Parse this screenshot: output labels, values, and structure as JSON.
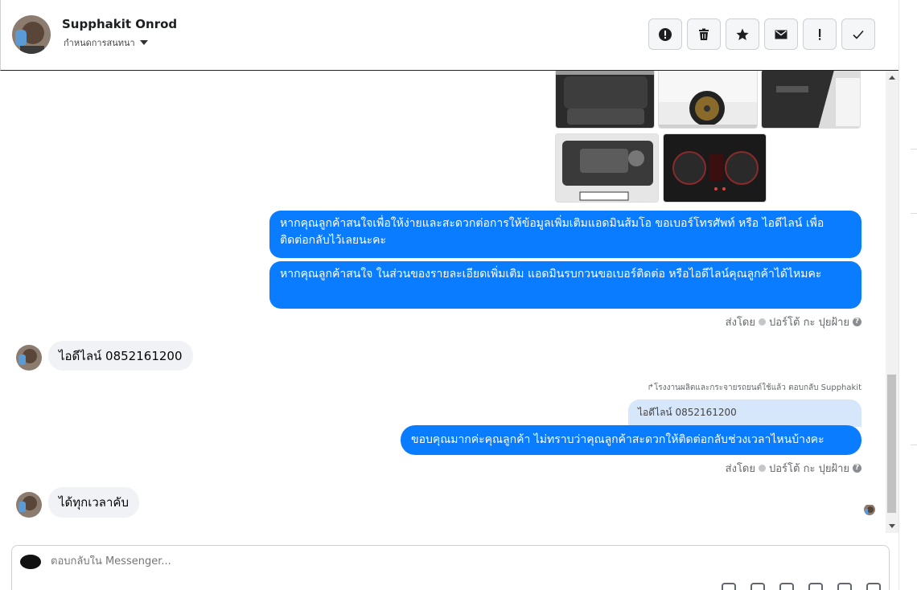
{
  "header": {
    "contact_name": "Supphakit Onrod",
    "assign_label": "กำหนดการสนทนา"
  },
  "actions": [
    {
      "name": "report-spam",
      "icon": "exclamation-circle-icon"
    },
    {
      "name": "delete",
      "icon": "trash-icon"
    },
    {
      "name": "star",
      "icon": "star-icon"
    },
    {
      "name": "mark-unread",
      "icon": "envelope-icon"
    },
    {
      "name": "mark-important",
      "icon": "exclamation-icon"
    },
    {
      "name": "mark-done",
      "icon": "check-icon"
    }
  ],
  "thread": {
    "outgoing_1": "หากคุณลูกค้าสนใจเพื่อให้ง่ายและสะดวกต่อการให้ข้อมูลเพิ่มเติมแอดมินส้มโอ ขอเบอร์โทรศัพท์ หรือ ไอดีไลน์ เพื่อติดต่อกลับไว้เลยนะคะ",
    "outgoing_2": "หากคุณลูกค้าสนใจ ในส่วนของรายละเอียดเพิ่มเติม แอดมินรบกวนขอเบอร์ติดต่อ หรือไอดีไลน์คุณลูกค้าได้ไหมคะ",
    "sent_by_1_prefix": "ส่งโดย",
    "sent_by_1_name": "ปอร์โต้ กะ ปุยฝ้าย",
    "incoming_1": "ไอดีไลน์ 0852161200",
    "reply_note": "โรงงานผลิตและกระจายรถยนต์ใช้แล้ว ตอบกลับ Supphakit",
    "quoted_text": "ไอดีไลน์ 0852161200",
    "outgoing_3": "ขอบคุณมากค่ะคุณลูกค้า ไม่ทราบว่าคุณลูกค้าสะดวกให้ติดต่อกลับช่วงเวลาไหนบ้างคะ",
    "sent_by_2_prefix": "ส่งโดย",
    "sent_by_2_name": "ปอร์โต้ กะ ปุยฝ้าย",
    "incoming_2": "ได้ทุกเวลาคับ"
  },
  "composer": {
    "placeholder": "ตอบกลับใน Messenger..."
  },
  "colors": {
    "outgoing_bubble": "#0a7cff",
    "incoming_bubble": "#f0f2f5"
  }
}
